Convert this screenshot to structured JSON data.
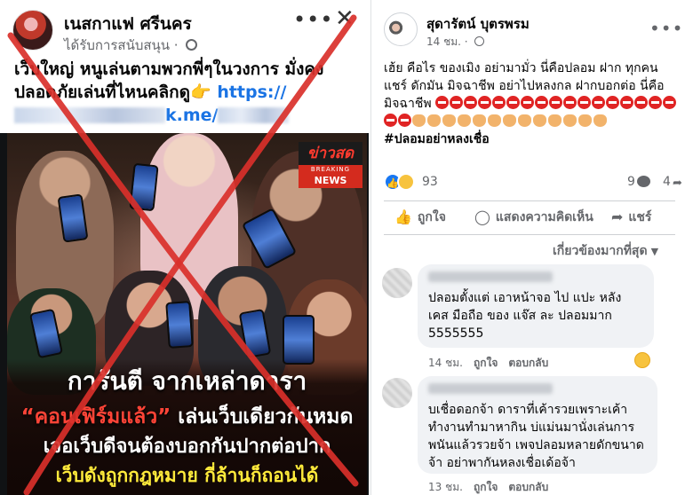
{
  "left_ad": {
    "page_name": "เนสกาแฟ ศรีนคร",
    "sponsored": "ได้รับการสนับสนุน",
    "more_icon": "more-horizontal-icon",
    "close_icon": "close-icon",
    "body_text": "เว็บใหญ่ หนูเล่นตามพวกพี่ๆในวงการ มั่งคง ปลอดภัยเล่นที่ไหนคลิกดู👉",
    "link_prefix": "https://",
    "link_suffix": "k.me/",
    "image": {
      "news_badge_top": "ข่าวสด",
      "news_badge_breaking": "BREAKING",
      "news_badge_news": "NEWS",
      "headline_1": "การันตี จากเหล่าดารา",
      "headline_2_quote": "“คอนเฟิร์มแล้ว”",
      "headline_2_rest": " เล่นเว็บเดียวกันหมด",
      "headline_3": "เจอเว็บดีจนต้องบอกกันปากต่อปาก",
      "headline_4": "เว็บดังถูกกฎหมาย กี่ล้านก็ถอนได้"
    },
    "overlay_color": "#d9302a"
  },
  "post": {
    "author": "สุดารัตน์ บุตรพรม",
    "time": "14 ชม.",
    "more_icon": "more-horizontal-icon",
    "text": "เฮ้ย คือไร ของเมิง อย่ามามั่ว นี่คือปลอม ฝาก ทุกคนแชร์ ดักมัน มิจฉาชีพ อย่าไปหลงกล ฝากบอกต่อ นี่คือมิจฉาชีพ",
    "hashtag": "#ปลอมอย่าหลงเชื่อ",
    "reactions_count": "93",
    "comments_count": "9",
    "shares_count": "4",
    "actions": {
      "like": "ถูกใจ",
      "comment": "แสดงความคิดเห็น",
      "share": "แชร์"
    },
    "sort_label": "เกี่ยวข้องมากที่สุด"
  },
  "comments": [
    {
      "text": "ปลอมตั้งแต่ เอาหน้าจอ ไป แปะ หลัง เคส มือถือ ของ แจ๊ส ละ ปลอมมาก 5555555",
      "time": "14 ชม.",
      "like": "ถูกใจ",
      "reply": "ตอบกลับ"
    },
    {
      "text": "บเชื่อดอกจ้า ดาราที่เค้ารวยเพราะเค้าทำงานทำมาหากิน บ่แม่นมานั่งเล่นการพนันแล้วรวยจ้า เพจปลอมหลายดักขนาดจ้า อย่าพากันหลงเชื่อเด้อจ้า",
      "time": "13 ชม.",
      "like": "ถูกใจ",
      "reply": "ตอบกลับ"
    }
  ],
  "colors": {
    "facebook_blue": "#1877f2",
    "link_blue": "#1b74e4",
    "secondary_text": "#65676b",
    "bubble_bg": "#f0f2f5",
    "cross_red": "#d9302a"
  }
}
